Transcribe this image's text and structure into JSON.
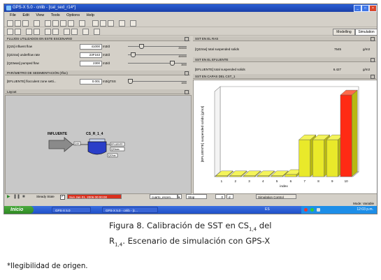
{
  "window": {
    "title": "GPS-X 5.0 - cnlib - [cal_sed_r14*]",
    "menu": [
      "File",
      "Edit",
      "View",
      "Tools",
      "Options",
      "Help"
    ],
    "mode_tabs": [
      "Modelling",
      "Simulation"
    ]
  },
  "influent_panel": {
    "title": "FLUJOS UTILIZADOS EN ESTE ESCENARIO",
    "rows": [
      {
        "label": "[Q15] influent flow",
        "value": "41000",
        "unit": "m3/d",
        "max": "200000",
        "fraction": 0.205
      },
      {
        "label": "[Q22ras] underflow rate",
        "value": "23F163",
        "unit": "m3/d",
        "max": "400000",
        "fraction": 0.05
      },
      {
        "label": "[Q23was] pumped flow",
        "value": "2300",
        "unit": "m3/d",
        "max": "3000",
        "fraction": 0.767
      }
    ]
  },
  "sed_param_panel": {
    "title": "PARÁMETRO DE SEDIMENTACIÓN (rfloc)",
    "row": {
      "label": "[EFLUENTE] flocculent zone setti...",
      "value": "0.001",
      "unit": "m3/gTSS",
      "max": "1000",
      "fraction": 0.0
    }
  },
  "layout_panel": {
    "title": "Layout",
    "influent_label": "INFLUENTE",
    "tank_label": "CS_R_1_4",
    "port_label": "Q15",
    "outputs": [
      "EFLUENTE",
      "Q23was",
      "Q22ras"
    ]
  },
  "sst_ras_panel": {
    "title": "SST EN EL RAS",
    "label": "[Q22ras] total suspended solids",
    "value": "7545",
    "unit": "g/m3"
  },
  "sst_efl_panel": {
    "title": "SST EN EL EFLUENTE",
    "label": "[EFLUENTE] total suspended solids",
    "value": "6.427",
    "unit": "g/m3"
  },
  "chart_panel": {
    "title": "SST EN CAPAS DEL CST_1"
  },
  "chart_data": {
    "type": "bar",
    "categories": [
      "1",
      "2",
      "3",
      "4",
      "5",
      "6",
      "7",
      "8",
      "9",
      "10"
    ],
    "values": [
      6,
      6,
      6,
      6,
      6,
      30,
      520,
      520,
      520,
      1150
    ],
    "xlabel": "index",
    "ylabel": "[EFLUENTE] suspended solids [g/m3]",
    "ylim": [
      0,
      1200
    ],
    "grid": false,
    "colors": {
      "front": "#e9e92a",
      "top": "#f4f45a",
      "side": "#b8b812",
      "last_front": "#ff2b14",
      "last_top": "#ff6a4a"
    }
  },
  "statusbar": {
    "steady_state": "Steady State",
    "time": "Sun Jan 01, 2006 00:00:00",
    "scenario": "cuarto_escen...",
    "step": "Stop",
    "counter": "0",
    "counter_unit": "d",
    "control": "Simulation Control",
    "mode": "Mode: Variable"
  },
  "taskbar": {
    "start": "Inicio",
    "tasks": [
      "GPS-X 5.0",
      "GPS-X 5.0 - cnlib - [c..."
    ],
    "lang": "ES",
    "clock": "12:03 p.m."
  },
  "caption": {
    "line1_prefix": "Figura 8. Calibración de SST en CS",
    "line1_sub": "1,4",
    "line1_suffix": " del",
    "line2_prefix": "R",
    "line2_sub": "1,4",
    "line2_suffix": ". Escenario de simulación con GPS-X"
  },
  "footnote": "*Ilegibilidad de origen."
}
